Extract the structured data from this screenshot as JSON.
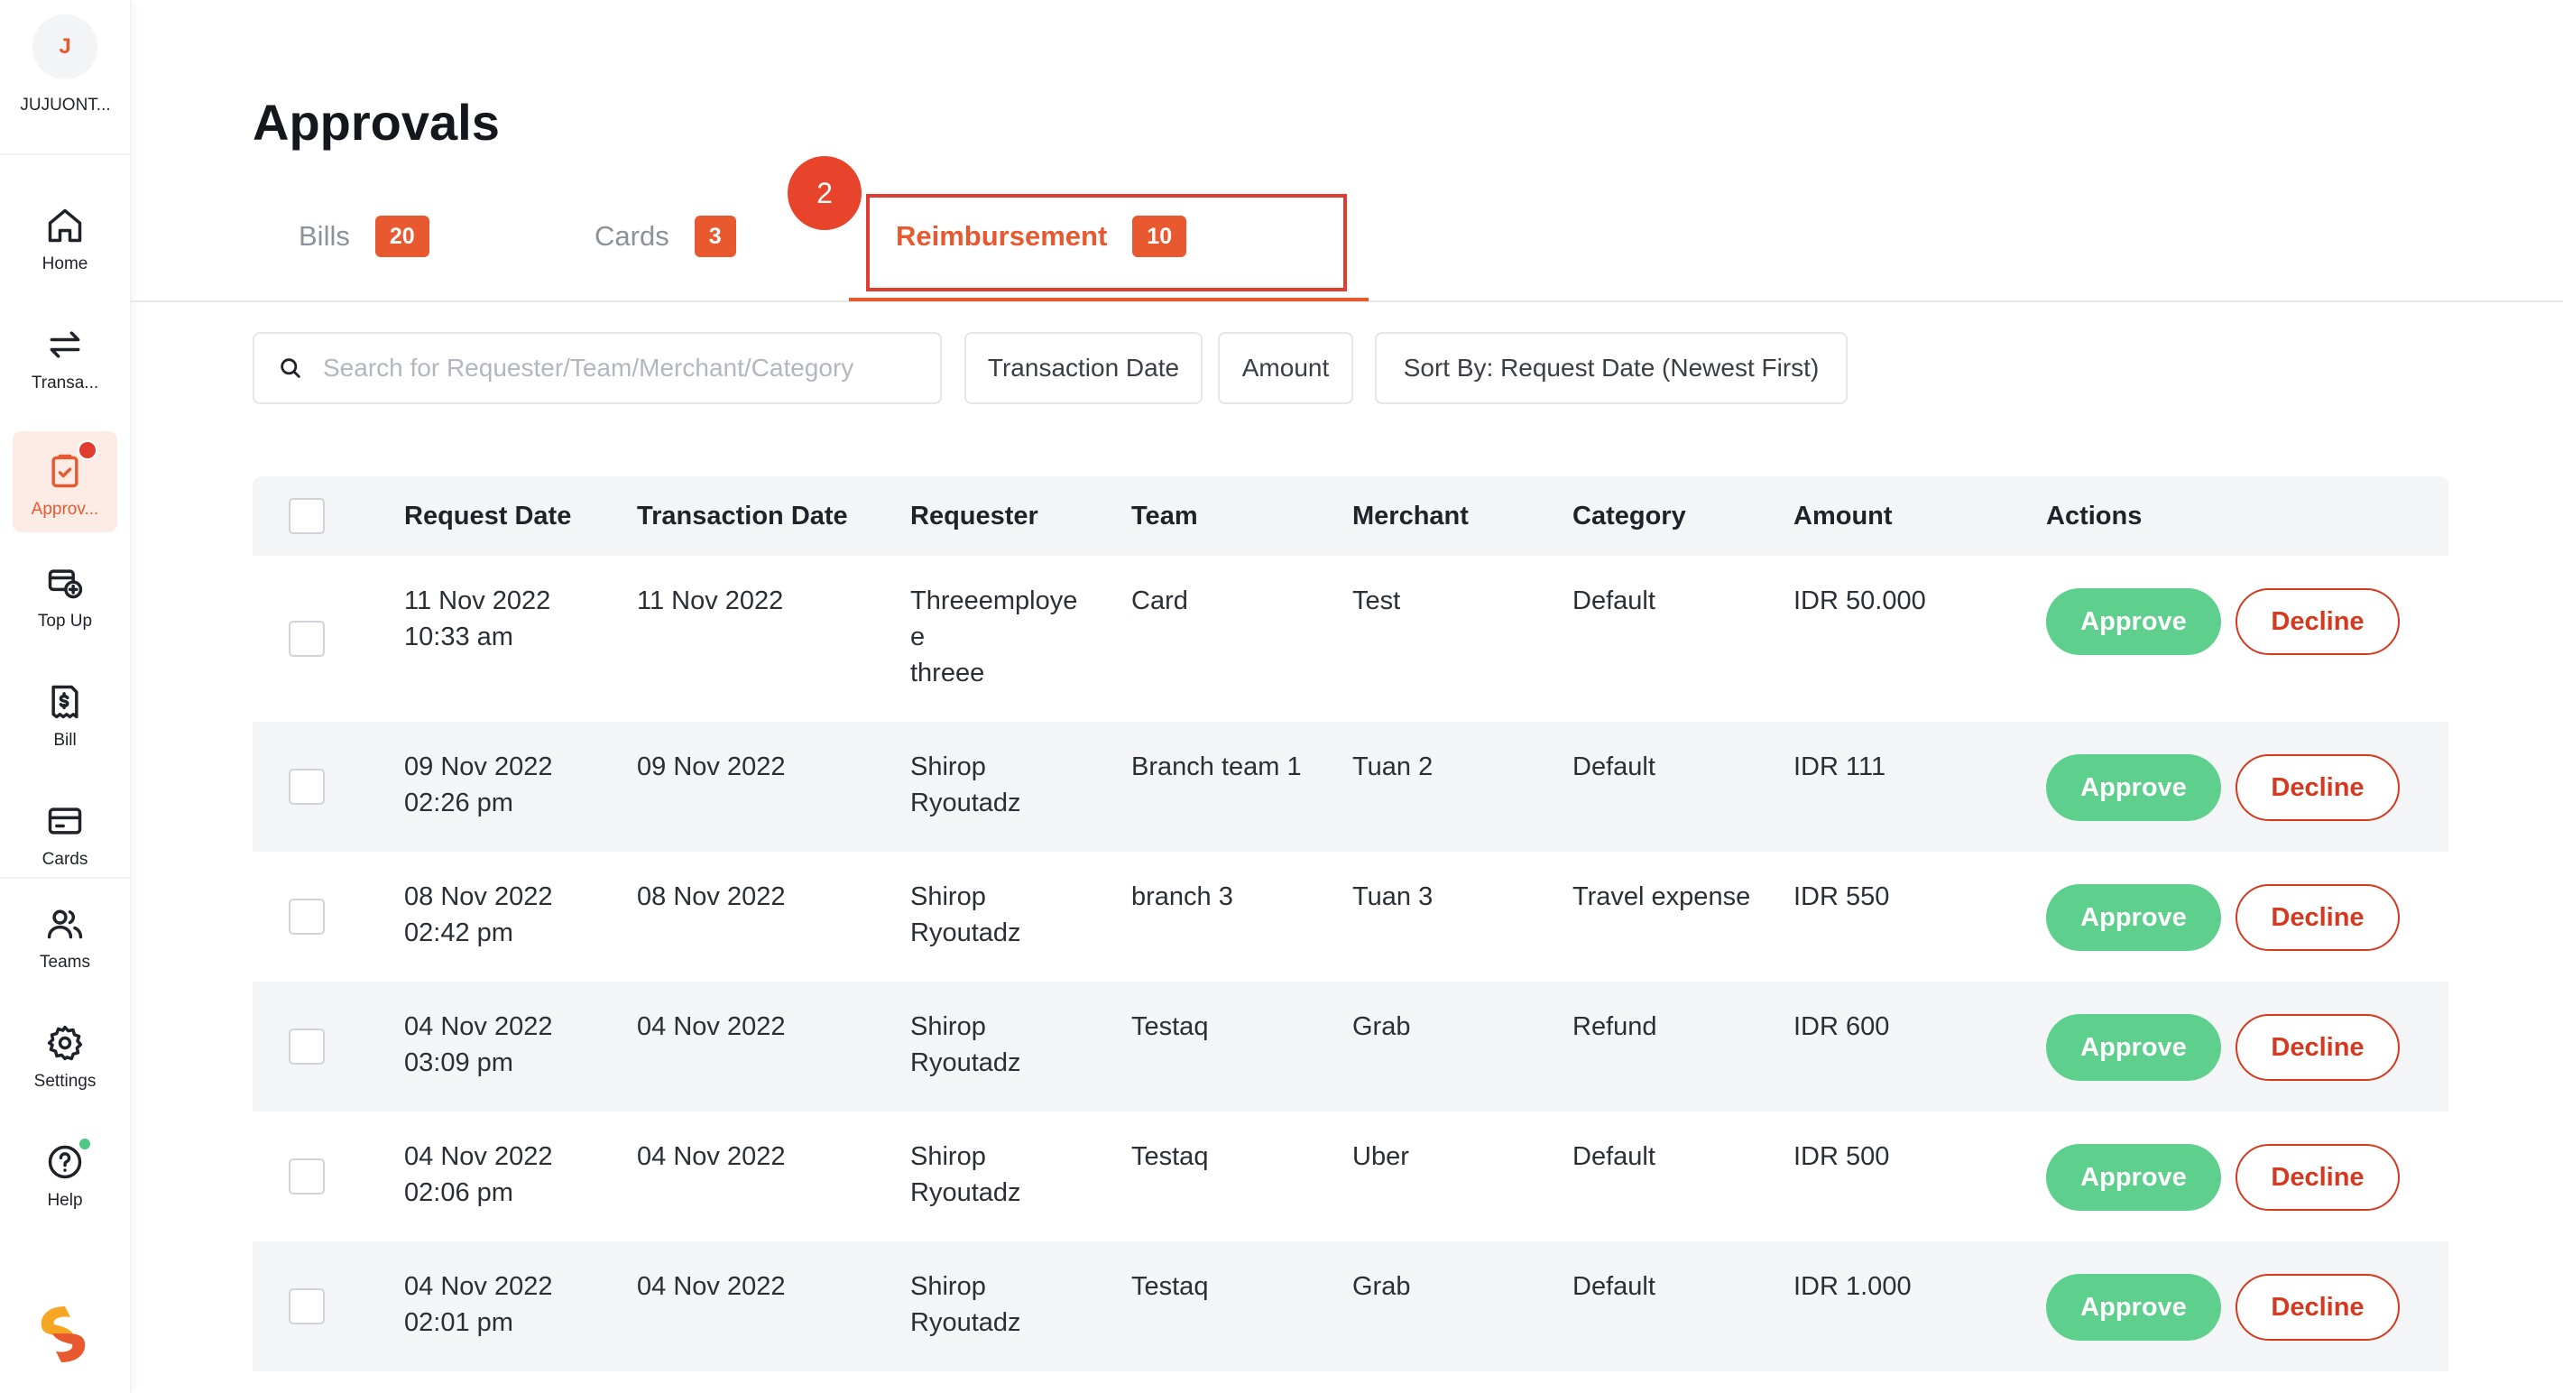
{
  "org": {
    "initial": "J",
    "name": "JUJUONT..."
  },
  "sidebar": {
    "items": [
      {
        "label": "Home",
        "icon": "home-icon"
      },
      {
        "label": "Transa...",
        "icon": "transfer-icon"
      },
      {
        "label": "Approv...",
        "icon": "approvals-icon",
        "active": true,
        "notification": true
      },
      {
        "label": "Top Up",
        "icon": "top-up-icon"
      },
      {
        "label": "Bill",
        "icon": "bill-icon"
      },
      {
        "label": "Cards",
        "icon": "card-icon"
      },
      {
        "label": "Teams",
        "icon": "teams-icon"
      },
      {
        "label": "Settings",
        "icon": "gear-icon"
      },
      {
        "label": "Help",
        "icon": "help-icon",
        "status_dot": true
      }
    ]
  },
  "page": {
    "title": "Approvals"
  },
  "tabs": [
    {
      "label": "Bills",
      "count": "20"
    },
    {
      "label": "Cards",
      "count": "3"
    },
    {
      "label": "Reimbursement",
      "count": "10",
      "active": true
    }
  ],
  "step_marker": "2",
  "filters": {
    "search_placeholder": "Search for Requester/Team/Merchant/Category",
    "transaction_date": "Transaction Date",
    "amount": "Amount",
    "sort": "Sort By: Request Date (Newest First)"
  },
  "table": {
    "columns": [
      "Request Date",
      "Transaction Date",
      "Requester",
      "Team",
      "Merchant",
      "Category",
      "Amount",
      "Actions"
    ],
    "approve_label": "Approve",
    "decline_label": "Decline",
    "rows": [
      {
        "request_date": "11 Nov 2022",
        "request_time": "10:33 am",
        "transaction_date": "11 Nov 2022",
        "requester_lines": [
          "Threeemploye",
          "e",
          "threee"
        ],
        "team": "Card",
        "merchant": "Test",
        "category": "Default",
        "amount": "IDR 50.000"
      },
      {
        "request_date": "09 Nov 2022",
        "request_time": "02:26 pm",
        "transaction_date": "09 Nov 2022",
        "requester_lines": [
          "Shirop",
          "Ryoutadz"
        ],
        "team": "Branch team 1",
        "merchant": "Tuan 2",
        "category": "Default",
        "amount": "IDR 111"
      },
      {
        "request_date": "08 Nov 2022",
        "request_time": "02:42 pm",
        "transaction_date": "08 Nov 2022",
        "requester_lines": [
          "Shirop",
          "Ryoutadz"
        ],
        "team": "branch 3",
        "merchant": "Tuan 3",
        "category": "Travel expense",
        "amount": "IDR 550"
      },
      {
        "request_date": "04 Nov 2022",
        "request_time": "03:09 pm",
        "transaction_date": "04 Nov 2022",
        "requester_lines": [
          "Shirop",
          "Ryoutadz"
        ],
        "team": "Testaq",
        "merchant": "Grab",
        "category": "Refund",
        "amount": "IDR 600"
      },
      {
        "request_date": "04 Nov 2022",
        "request_time": "02:06 pm",
        "transaction_date": "04 Nov 2022",
        "requester_lines": [
          "Shirop",
          "Ryoutadz"
        ],
        "team": "Testaq",
        "merchant": "Uber",
        "category": "Default",
        "amount": "IDR 500"
      },
      {
        "request_date": "04 Nov 2022",
        "request_time": "02:01 pm",
        "transaction_date": "04 Nov 2022",
        "requester_lines": [
          "Shirop",
          "Ryoutadz"
        ],
        "team": "Testaq",
        "merchant": "Grab",
        "category": "Default",
        "amount": "IDR 1.000"
      }
    ]
  },
  "colors": {
    "accent": "#e8592f",
    "approve": "#5fcf8d",
    "decline": "#d5391f",
    "highlight": "#e23b2f"
  }
}
